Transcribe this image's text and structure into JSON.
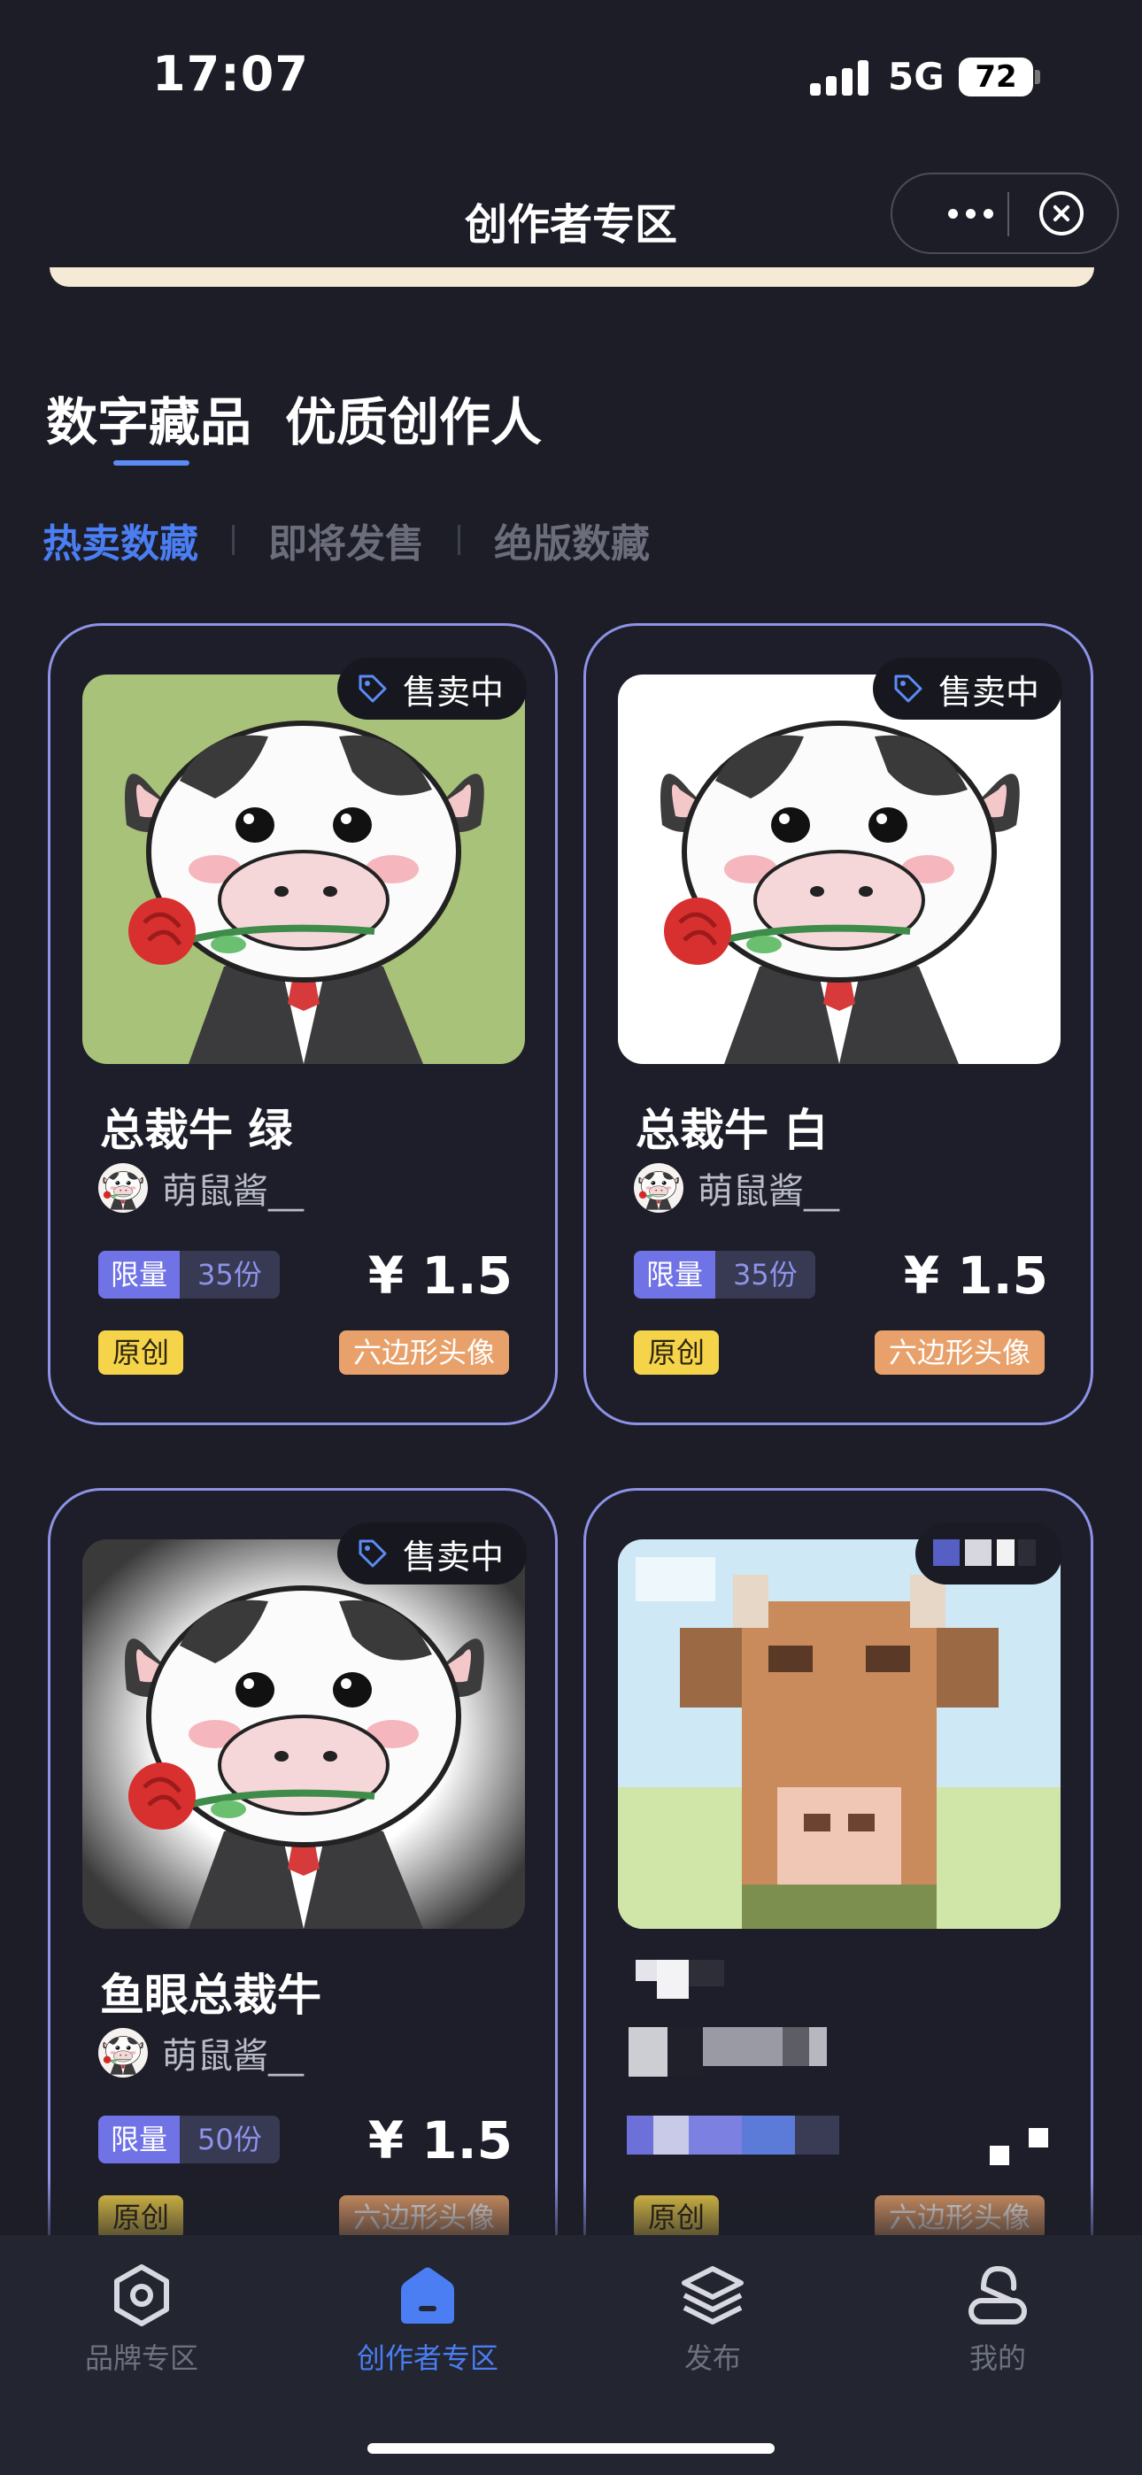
{
  "status": {
    "time": "17:07",
    "network": "5G",
    "battery": "72"
  },
  "nav": {
    "title": "创作者专区"
  },
  "main_tabs": [
    "数字藏品",
    "优质创作人"
  ],
  "sub_tabs": [
    "热卖数藏",
    "即将发售",
    "绝版数藏"
  ],
  "cards": [
    {
      "status": "售卖中",
      "title": "总裁牛 绿",
      "author": "萌鼠酱__",
      "limit_label": "限量",
      "limit_value": "35份",
      "price": "¥ 1.5",
      "tag1": "原创",
      "tag2": "六边形头像",
      "bg": "#a9c27a"
    },
    {
      "status": "售卖中",
      "title": "总裁牛 白",
      "author": "萌鼠酱__",
      "limit_label": "限量",
      "limit_value": "35份",
      "price": "¥ 1.5",
      "tag1": "原创",
      "tag2": "六边形头像",
      "bg": "#ffffff"
    },
    {
      "status": "售卖中",
      "title": "鱼眼总裁牛",
      "author": "萌鼠酱__",
      "limit_label": "限量",
      "limit_value": "50份",
      "price": "¥ 1.5",
      "tag1": "原创",
      "tag2": "六边形头像",
      "bg": "#f2f2f2"
    },
    {
      "tag1": "原创",
      "tag2": "六边形头像"
    }
  ],
  "tabbar": [
    {
      "label": "品牌专区",
      "icon": "hexagon-icon"
    },
    {
      "label": "创作者专区",
      "icon": "home-icon"
    },
    {
      "label": "发布",
      "icon": "layers-icon"
    },
    {
      "label": "我的",
      "icon": "user-icon"
    }
  ],
  "colors": {
    "accent": "#4a7ef2",
    "card_border": "#8e92e6",
    "background": "#1c1d27"
  }
}
